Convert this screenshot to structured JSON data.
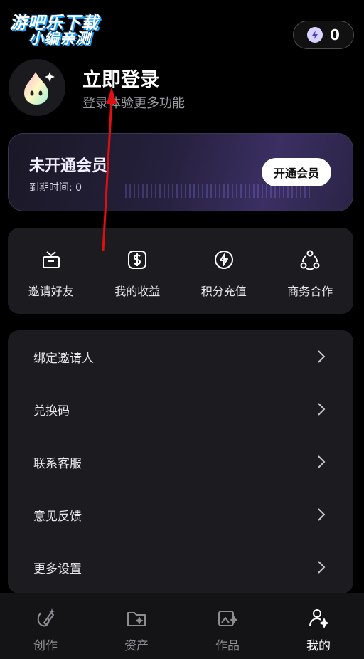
{
  "watermark": {
    "line1": "游吧乐下载",
    "line2": "小编亲测"
  },
  "points": {
    "value": "0",
    "icon": "lightning-icon"
  },
  "profile": {
    "title": "立即登录",
    "subtitle": "登录体验更多功能",
    "avatar_icon": "droplet-mascot-icon"
  },
  "vip": {
    "title": "未开通会员",
    "expire": "到期时间: 0",
    "button": "开通会员"
  },
  "actions": [
    {
      "label": "邀请好友",
      "icon": "gift-icon"
    },
    {
      "label": "我的收益",
      "icon": "dollar-icon"
    },
    {
      "label": "积分充值",
      "icon": "lightning-circle-icon"
    },
    {
      "label": "商务合作",
      "icon": "cooperation-icon"
    }
  ],
  "menu": [
    {
      "label": "绑定邀请人"
    },
    {
      "label": "兑换码"
    },
    {
      "label": "联系客服"
    },
    {
      "label": "意见反馈"
    },
    {
      "label": "更多设置"
    }
  ],
  "tabs": [
    {
      "label": "创作",
      "icon": "create-icon",
      "active": false
    },
    {
      "label": "资产",
      "icon": "assets-icon",
      "active": false
    },
    {
      "label": "作品",
      "icon": "works-icon",
      "active": false
    },
    {
      "label": "我的",
      "icon": "profile-icon",
      "active": true
    }
  ],
  "colors": {
    "background": "#000000",
    "card": "#1c1c20",
    "annotation": "#e01010",
    "vip_accent": "#3b2f63"
  }
}
